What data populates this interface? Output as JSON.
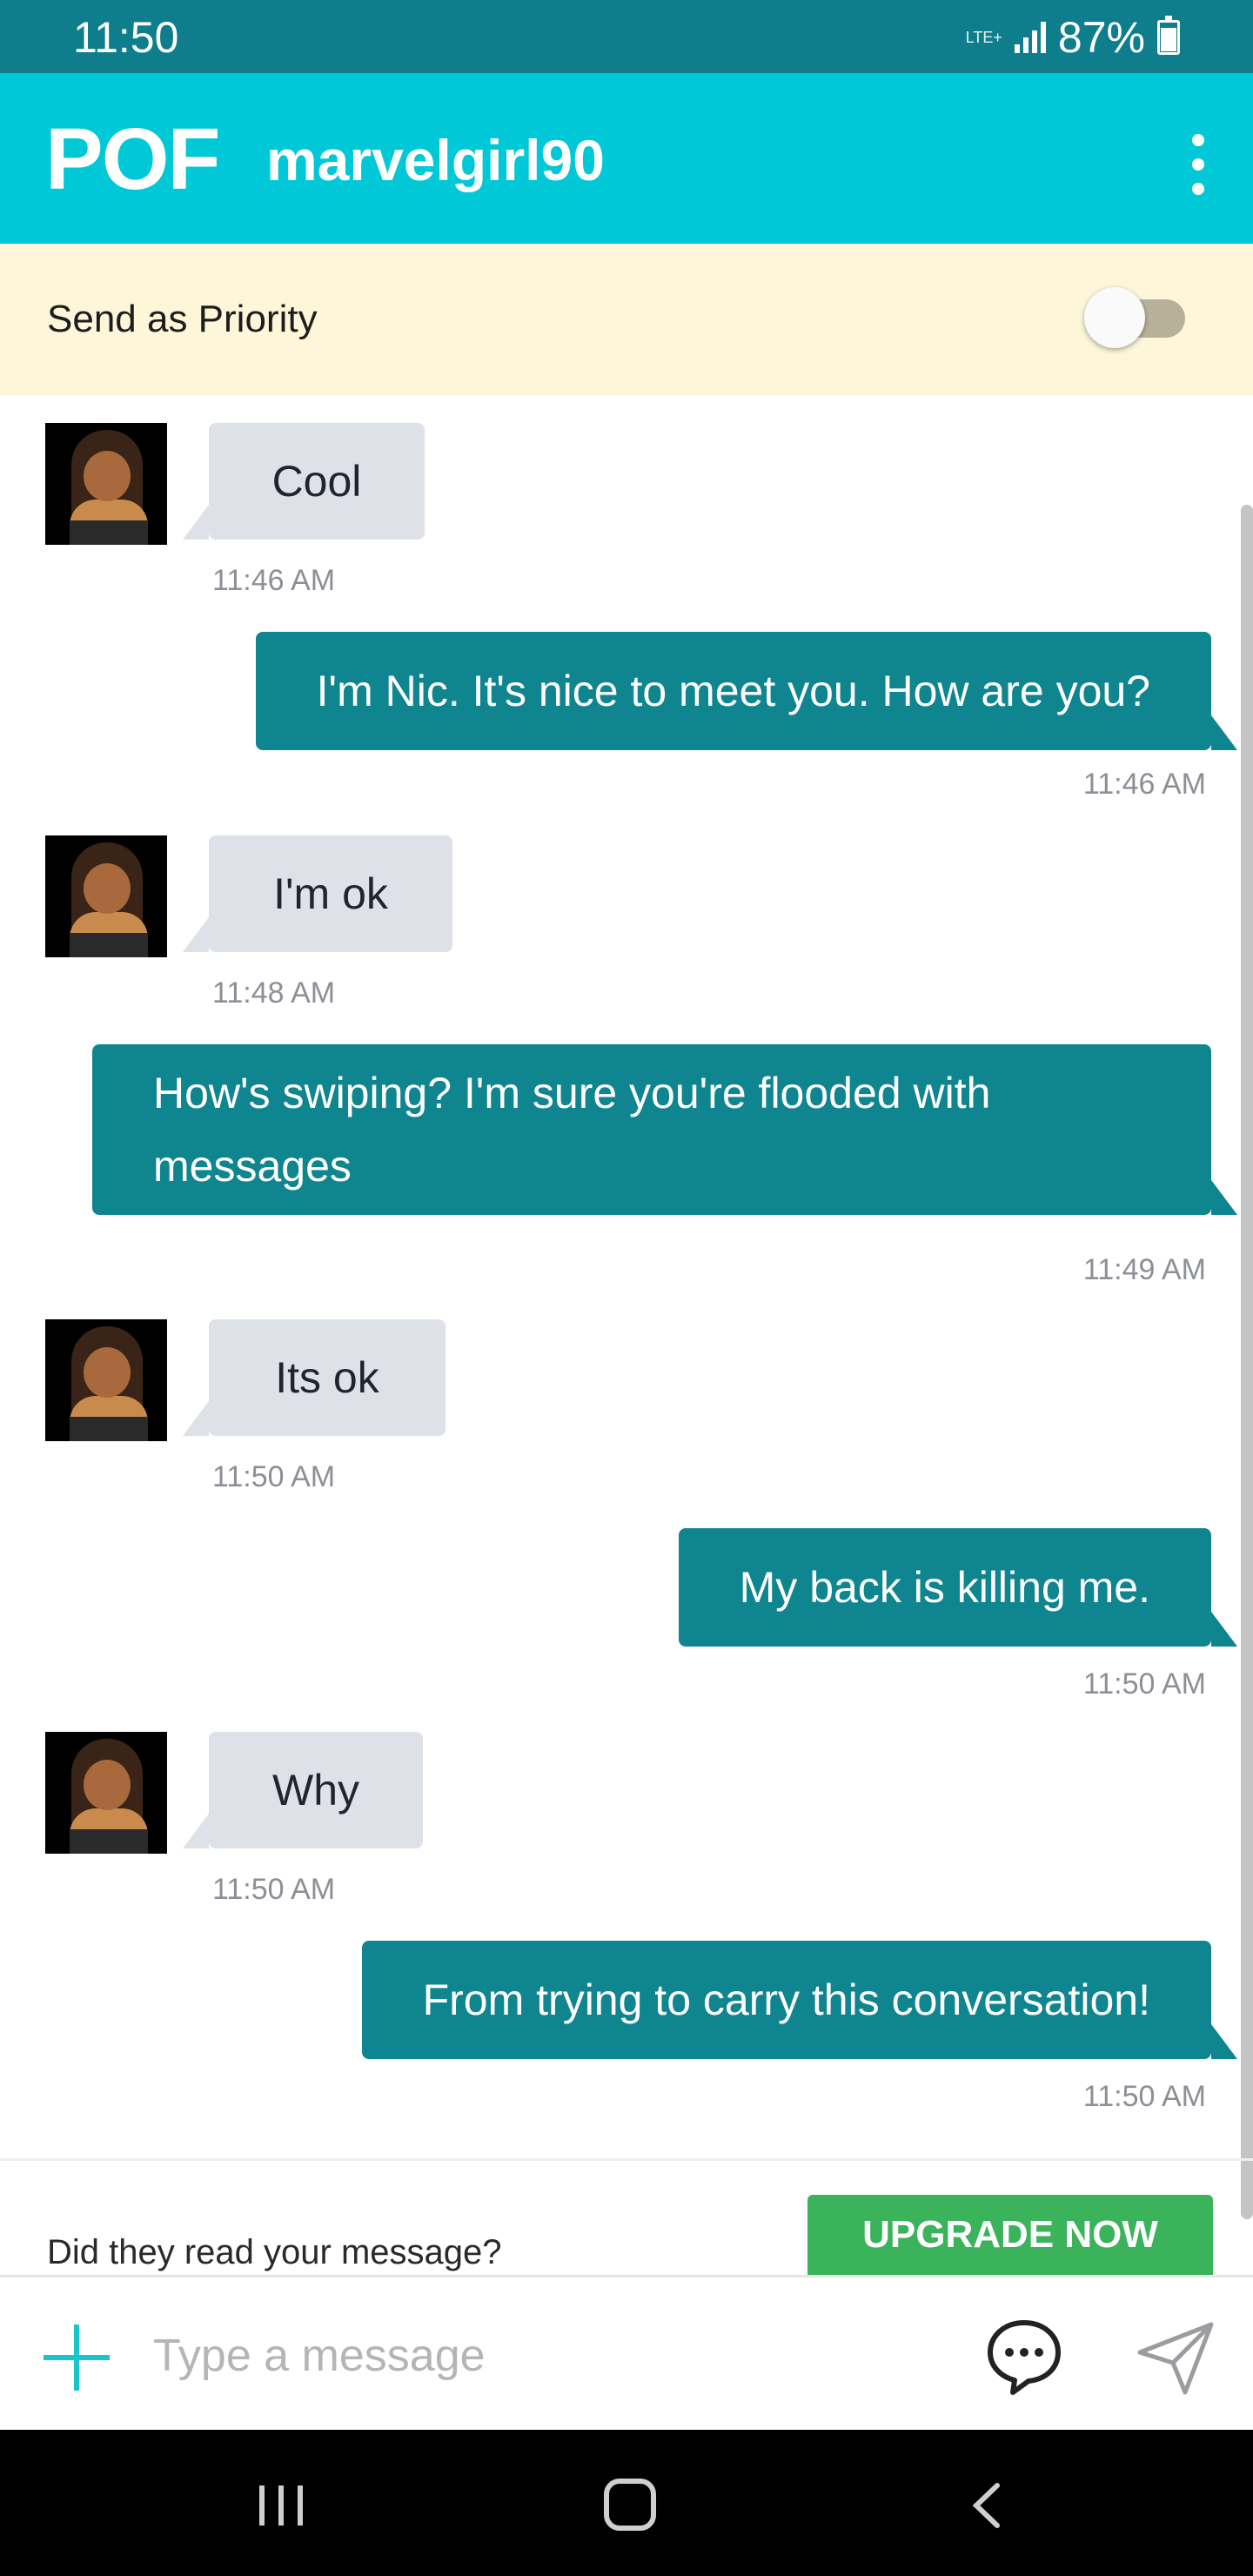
{
  "status_bar": {
    "time": "11:50",
    "network": "LTE+",
    "battery": "87%"
  },
  "header": {
    "logo": "POF",
    "username": "marvelgirl90"
  },
  "priority": {
    "label": "Send as Priority",
    "enabled": false
  },
  "messages": [
    {
      "direction": "in",
      "text": "Cool",
      "time": "11:46 AM"
    },
    {
      "direction": "out",
      "text": "I'm Nic. It's nice to meet you. How are you?",
      "time": "11:46 AM"
    },
    {
      "direction": "in",
      "text": "I'm ok",
      "time": "11:48 AM"
    },
    {
      "direction": "out",
      "text": "How's swiping? I'm sure you're flooded with messages",
      "time": "11:49 AM"
    },
    {
      "direction": "in",
      "text": "Its ok",
      "time": "11:50 AM"
    },
    {
      "direction": "out",
      "text": "My back is killing me.",
      "time": "11:50 AM"
    },
    {
      "direction": "in",
      "text": "Why",
      "time": "11:50 AM"
    },
    {
      "direction": "out",
      "text": "From trying to carry this conversation!",
      "time": "11:50 AM"
    }
  ],
  "upgrade": {
    "prompt": "Did they read your message?",
    "button": "UPGRADE NOW"
  },
  "compose": {
    "placeholder": "Type a message"
  },
  "colors": {
    "header": "#00c8d7",
    "status_bar": "#0e7e8c",
    "outgoing_bubble": "#0e858f",
    "incoming_bubble": "#dfe1e8",
    "upgrade_button": "#3ab35b",
    "priority_bg": "#fdf6d8"
  },
  "icons": [
    "kebab-menu-icon",
    "plus-icon",
    "chat-bubble-icon",
    "send-icon",
    "nav-recent-icon",
    "nav-home-icon",
    "nav-back-icon"
  ]
}
